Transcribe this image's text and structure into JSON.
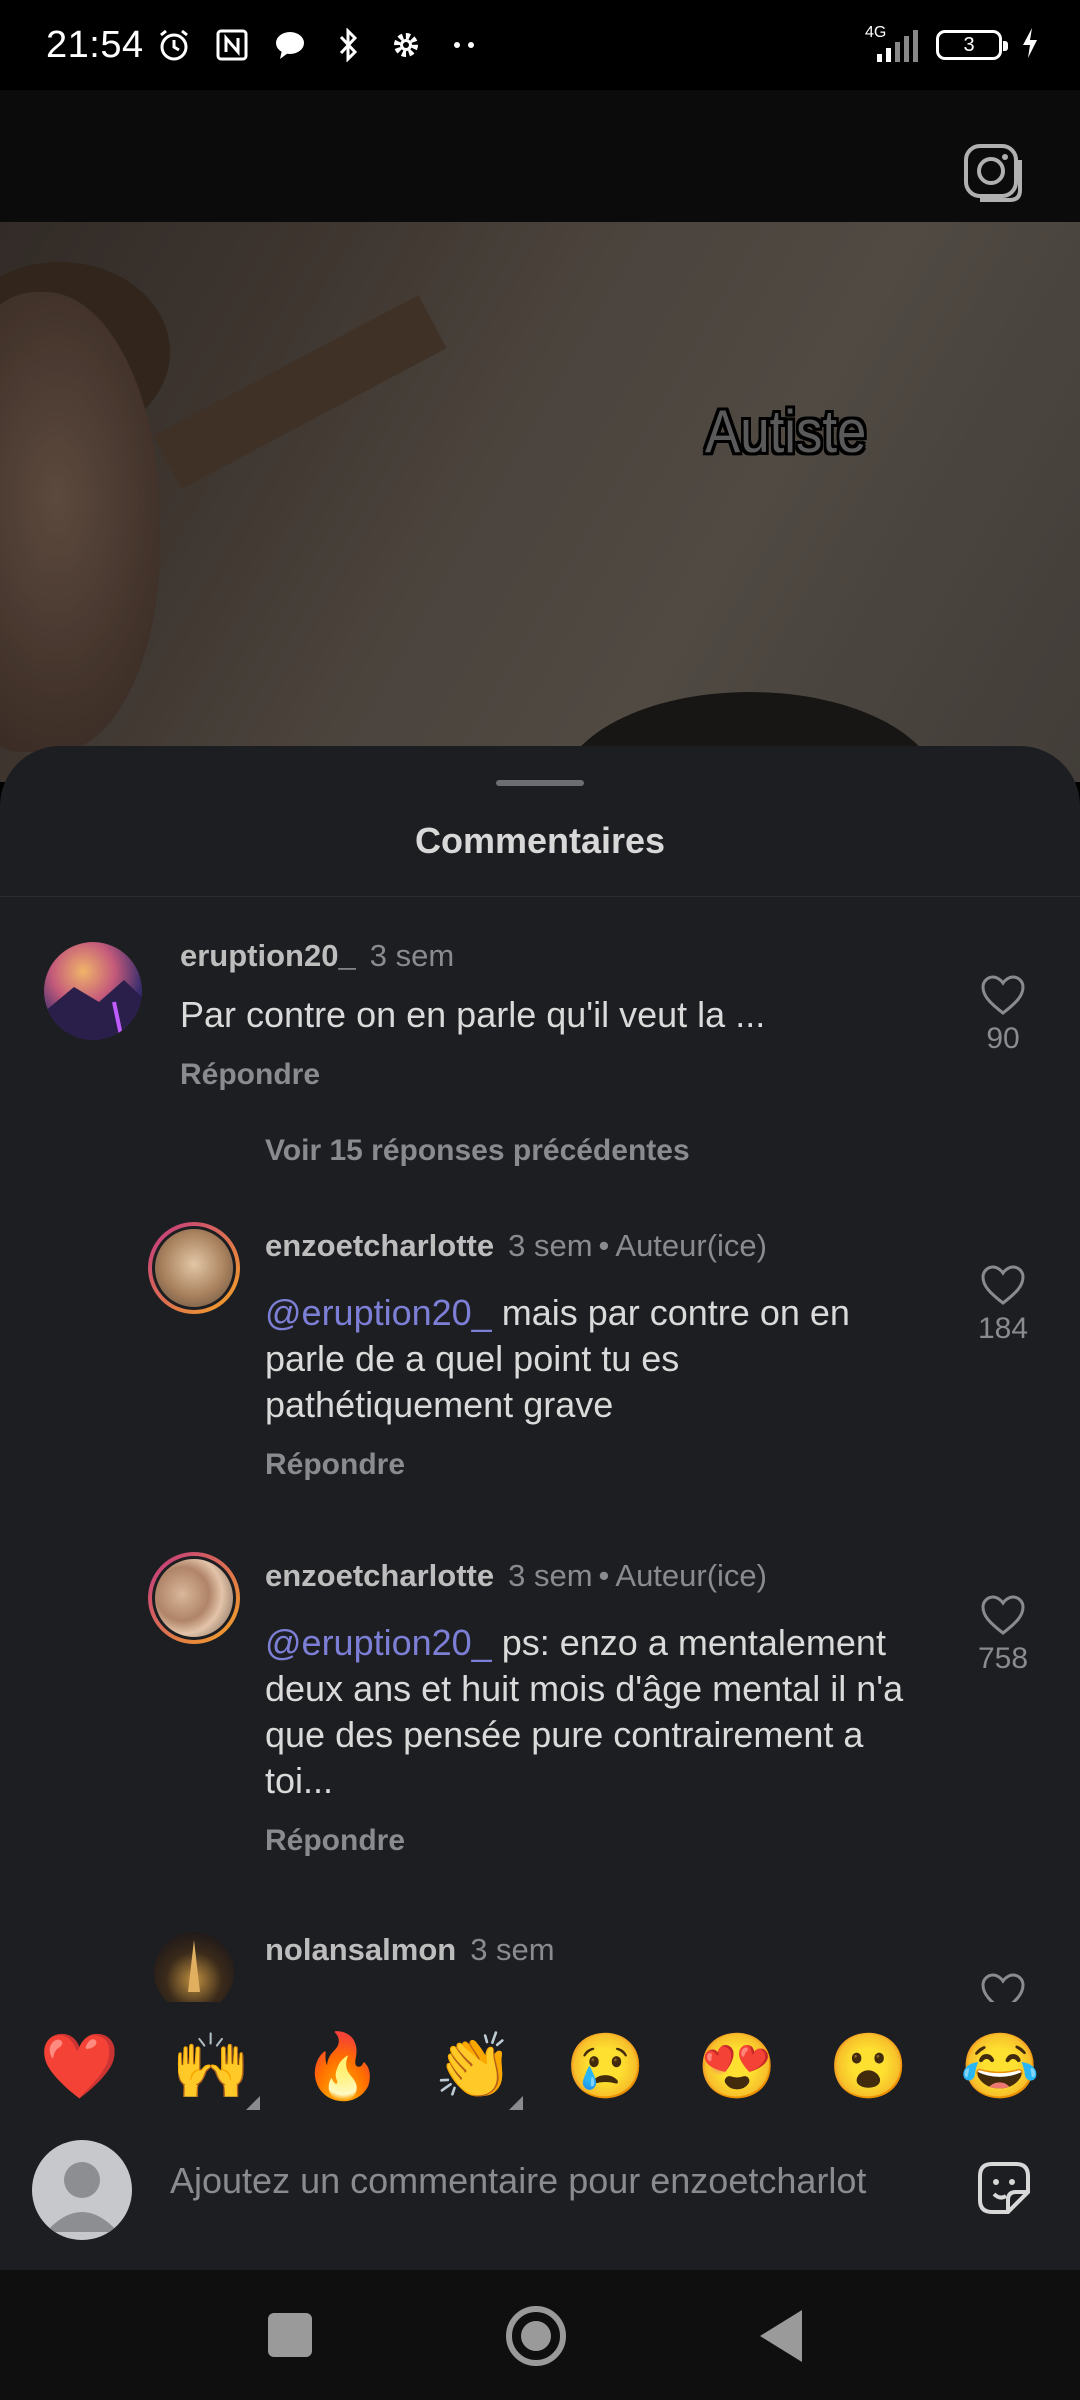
{
  "status_bar": {
    "time": "21:54",
    "network": "4G",
    "battery": "3",
    "icons": [
      "alarm-icon",
      "nfc-icon",
      "chat-bubble-icon",
      "bluetooth-icon",
      "settings-icon",
      "more-dots-icon"
    ]
  },
  "video": {
    "caption": "Autiste"
  },
  "sheet": {
    "title": "Commentaires"
  },
  "comments": [
    {
      "username": "eruption20_",
      "time": "3 sem",
      "text": "Par contre on en parle qu'il veut la ...",
      "reply_label": "Répondre",
      "likes": "90"
    }
  ],
  "see_more": "Voir 15 réponses précédentes",
  "replies": [
    {
      "username": "enzoetcharlotte",
      "time": "3 sem",
      "author_badge": "Auteur(ice)",
      "mention": "@eruption20_",
      "text": " mais par contre on en parle de a quel point tu es pathétiquement grave",
      "reply_label": "Répondre",
      "likes": "184"
    },
    {
      "username": "enzoetcharlotte",
      "time": "3 sem",
      "author_badge": "Auteur(ice)",
      "mention": "@eruption20_",
      "text": " ps: enzo a mentalement deux ans et huit mois d'âge mental il n'a que des pensée pure contrairement a toi...",
      "reply_label": "Répondre",
      "likes": "758"
    },
    {
      "username": "nolansalmon",
      "time": "3 sem"
    }
  ],
  "emoji_reactions": [
    "❤️",
    "🙌",
    "🔥",
    "👏",
    "😢",
    "😍",
    "😮",
    "😂"
  ],
  "input": {
    "placeholder": "Ajoutez un commentaire pour enzoetcharlot"
  },
  "colors": {
    "sheet_bg": "#1d1e21",
    "mention": "#7d7fd6",
    "secondary_text": "#8a8b8f"
  }
}
